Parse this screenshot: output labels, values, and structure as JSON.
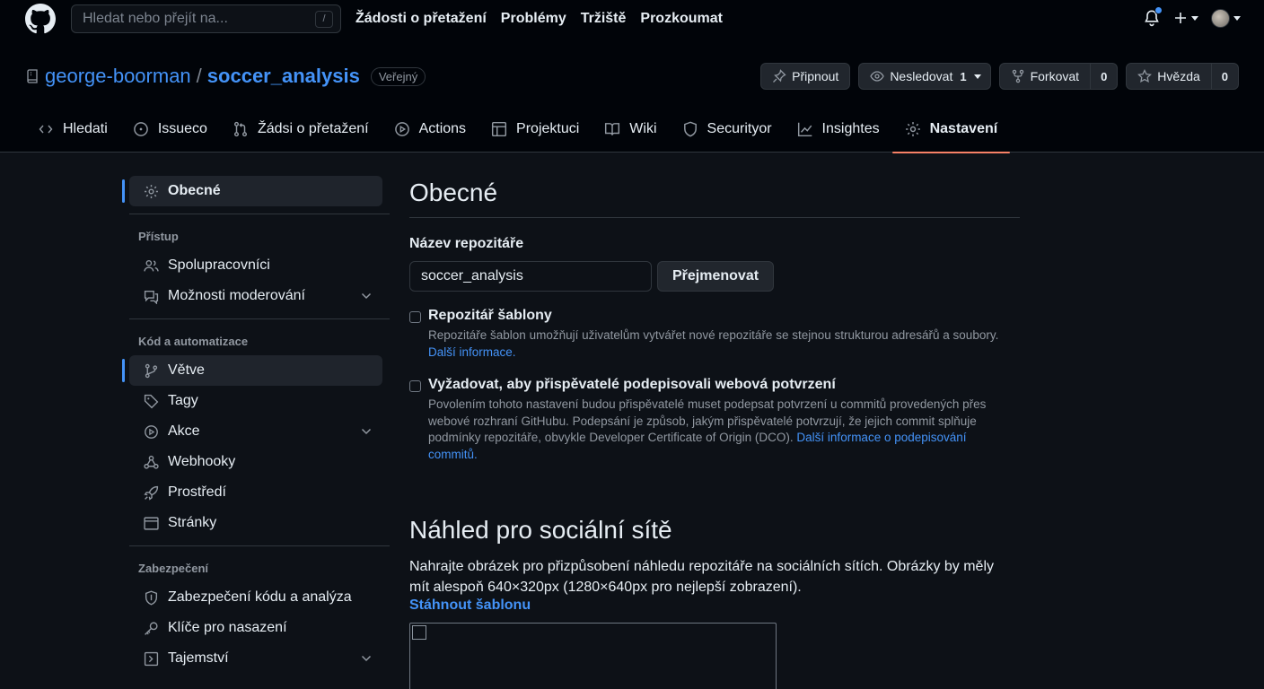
{
  "header": {
    "search_placeholder": "Hledat nebo přejít na...",
    "search_shortcut": "/",
    "nav": [
      "Žádosti o přetažení",
      "Problémy",
      "Tržiště",
      "Prozkoumat"
    ]
  },
  "repo": {
    "owner": "george-boorman",
    "separator": "/",
    "name": "soccer_analysis",
    "visibility": "Veřejný",
    "actions": {
      "pin": "Připnout",
      "watch": "Nesledovat",
      "watch_count": "1",
      "fork": "Forkovat",
      "fork_count": "0",
      "star": "Hvězda",
      "star_count": "0"
    },
    "tabs": [
      "Hledati",
      "Issueco",
      "Žádsi o přetažení",
      "Actions",
      "Projektuci",
      "Wiki",
      "Securityor",
      "Insightes",
      "Nastavení"
    ]
  },
  "sidebar": {
    "general": "Obecné",
    "access_heading": "Přístup",
    "collaborators": "Spolupracovníci",
    "moderation": "Možnosti moderování",
    "code_heading": "Kód a automatizace",
    "branches": "Větve",
    "tags": "Tagy",
    "actions": "Akce",
    "webhooks": "Webhooky",
    "environments": "Prostředí",
    "pages": "Stránky",
    "security_heading": "Zabezpečení",
    "code_security": "Zabezpečení kódu a analýza",
    "deploy_keys": "Klíče pro nasazení",
    "secrets": "Tajemství"
  },
  "main": {
    "title": "Obecné",
    "repo_name_label": "Název repozitáře",
    "repo_name_value": "soccer_analysis",
    "rename_button": "Přejmenovat",
    "template": {
      "title": "Repozitář šablony",
      "desc": "Repozitáře šablon umožňují uživatelům vytvářet nové repozitáře se stejnou strukturou adresářů a soubory.",
      "link": "Další informace."
    },
    "signoff": {
      "title": "Vyžadovat, aby přispěvatelé podepisovali webová potvrzení",
      "desc": "Povolením tohoto nastavení budou přispěvatelé muset podepsat potvrzení u commitů provedených přes webové rozhraní GitHubu. Podepsání je způsob, jakým přispěvatelé potvrzují, že jejich commit splňuje podmínky repozitáře, obvykle Developer Certificate of Origin (DCO).",
      "link": "Další informace o podepisování commitů."
    },
    "social": {
      "title": "Náhled pro sociální sítě",
      "desc": "Nahrajte obrázek pro přizpůsobení náhledu repozitáře na sociálních sítích. Obrázky by měly mít alespoň 640×320px (1280×640px pro nejlepší zobrazení).",
      "download": "Stáhnout šablonu"
    }
  }
}
